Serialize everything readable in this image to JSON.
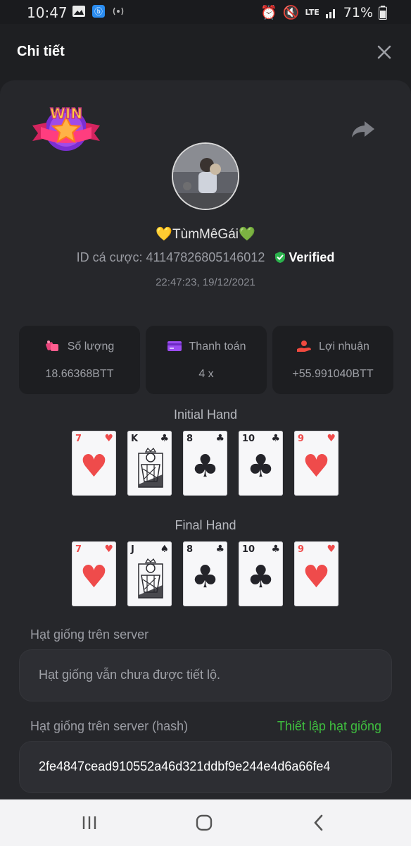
{
  "status_bar": {
    "time": "10:47",
    "network": "LTE",
    "battery": "71%"
  },
  "header": {
    "title": "Chi tiết"
  },
  "player": {
    "username": "💛TùmMêGái💚",
    "bet_id_label": "ID cá cược:",
    "bet_id": "41147826805146012",
    "verified_label": "Verified",
    "timestamp": "22:47:23, 19/12/2021"
  },
  "badge": {
    "text": "WIN"
  },
  "stats": [
    {
      "label": "Số lượng",
      "value": "18.66368BTT",
      "icon": "coins-icon"
    },
    {
      "label": "Thanh toán",
      "value": "4 x",
      "icon": "card-payment-icon"
    },
    {
      "label": "Lợi nhuận",
      "value": "+55.991040BTT",
      "icon": "profit-hand-icon"
    }
  ],
  "initial_hand": {
    "title": "Initial Hand",
    "cards": [
      {
        "rank": "7",
        "suit": "♥",
        "color": "red"
      },
      {
        "rank": "K",
        "suit": "♣",
        "color": "black"
      },
      {
        "rank": "8",
        "suit": "♣",
        "color": "black"
      },
      {
        "rank": "10",
        "suit": "♣",
        "color": "black"
      },
      {
        "rank": "9",
        "suit": "♥",
        "color": "red"
      }
    ]
  },
  "final_hand": {
    "title": "Final Hand",
    "cards": [
      {
        "rank": "7",
        "suit": "♥",
        "color": "red"
      },
      {
        "rank": "J",
        "suit": "♠",
        "color": "black"
      },
      {
        "rank": "8",
        "suit": "♣",
        "color": "black"
      },
      {
        "rank": "10",
        "suit": "♣",
        "color": "black"
      },
      {
        "rank": "9",
        "suit": "♥",
        "color": "red"
      }
    ]
  },
  "server_seed": {
    "label": "Hạt giống trên server",
    "value": "Hạt giống vẫn chưa được tiết lộ."
  },
  "server_seed_hash": {
    "label": "Hạt giống trên server (hash)",
    "link": "Thiết lập hạt giống",
    "value": "2fe4847cead910552a46d321ddbf9e244e4d6a66fe4"
  },
  "colors": {
    "accent_green": "#3fbf3f",
    "card_red": "#ef4b4b",
    "background": "#1e1f22"
  }
}
